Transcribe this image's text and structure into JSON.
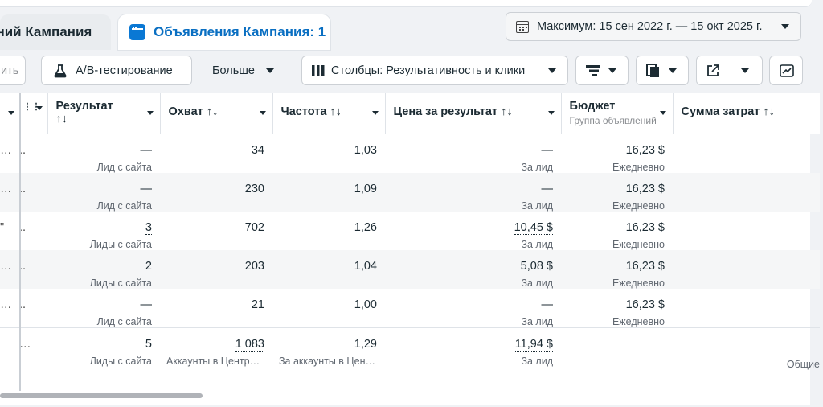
{
  "tabs": [
    {
      "label": "ений Кампания"
    },
    {
      "label": "Объявления Кампания: 1"
    }
  ],
  "date_range": {
    "label": "Максимум: 15 сен 2022 г. — 15 окт 2025 г."
  },
  "toolbar": {
    "partial_label": "ить",
    "ab_label": "A/B-тестирование",
    "more_label": "Больше",
    "columns_label": "Столбцы: Результативность и клики"
  },
  "columns": [
    {
      "label": "Результат",
      "sort": "↑↓"
    },
    {
      "label": "Охват ↑↓"
    },
    {
      "label": "Частота ↑↓"
    },
    {
      "label": "Цена за результат ↑↓"
    },
    {
      "label": "Бюджет",
      "sub": "Группа объявлений"
    },
    {
      "label": "Сумма затрат ↑↓"
    }
  ],
  "rows": [
    {
      "c1": "…",
      "c2": "..",
      "result": "—",
      "result_sub": "Лид с сайта",
      "reach": "34",
      "freq": "1,03",
      "cpr": "—",
      "cpr_sub": "За лид",
      "budget": "16,23 $",
      "budget_sub": "Ежедневно",
      "spend": ""
    },
    {
      "c1": "…",
      "c2": "..",
      "result": "—",
      "result_sub": "Лид с сайта",
      "reach": "230",
      "freq": "1,09",
      "cpr": "—",
      "cpr_sub": "За лид",
      "budget": "16,23 $",
      "budget_sub": "Ежедневно",
      "spend": ""
    },
    {
      "c1": "\"",
      "c2": "..",
      "result": "3",
      "result_sub": "Лиды с сайта",
      "reach": "702",
      "freq": "1,26",
      "cpr": "10,45 $",
      "cpr_sub": "За лид",
      "budget": "16,23 $",
      "budget_sub": "Ежедневно",
      "spend": ""
    },
    {
      "c1": "…",
      "c2": "..",
      "result": "2",
      "result_sub": "Лиды с сайта",
      "reach": "203",
      "freq": "1,04",
      "cpr": "5,08 $",
      "cpr_sub": "За лид",
      "budget": "16,23 $",
      "budget_sub": "Ежедневно",
      "spend": ""
    },
    {
      "c1": "…",
      "c2": "..",
      "result": "—",
      "result_sub": "Лид с сайта",
      "reach": "21",
      "freq": "1,00",
      "cpr": "—",
      "cpr_sub": "За лид",
      "budget": "16,23 $",
      "budget_sub": "Ежедневно",
      "spend": ""
    }
  ],
  "totals": {
    "c2": "…",
    "result": "5",
    "result_sub": "Лиды с сайта",
    "reach": "1 083",
    "reach_sub": "Аккаунты в Центр…",
    "freq": "1,29",
    "freq_sub": "За аккаунты в Цен…",
    "cpr": "11,94 $",
    "cpr_sub": "За лид",
    "spend_sub": "Общие"
  }
}
